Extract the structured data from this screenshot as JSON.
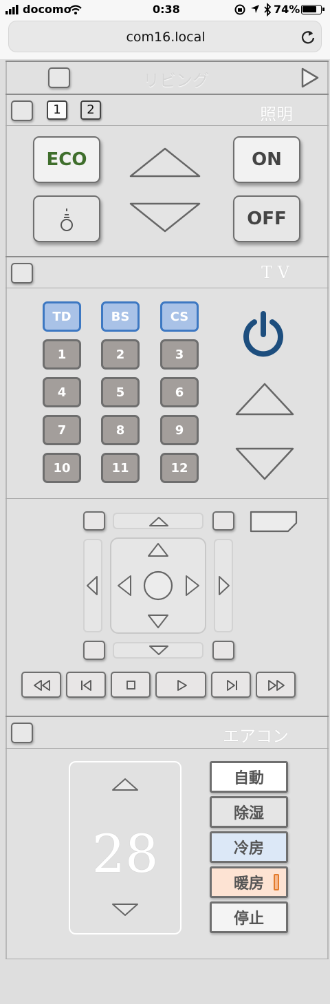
{
  "status_bar": {
    "carrier": "docomo",
    "time": "0:38",
    "battery": "74%"
  },
  "browser": {
    "url": "com16.local"
  },
  "room": {
    "title": "リビング"
  },
  "lighting": {
    "title": "照明",
    "selectors": [
      "1",
      "2"
    ],
    "eco_label": "ECO",
    "on_label": "ON",
    "off_label": "OFF",
    "eco_color": "#3f6e2c"
  },
  "tv": {
    "title": "T V",
    "sources": [
      "TD",
      "BS",
      "CS"
    ],
    "channels": [
      "1",
      "2",
      "3",
      "4",
      "5",
      "6",
      "7",
      "8",
      "9",
      "10",
      "11",
      "12"
    ],
    "source_color": "#a9c2e7",
    "power_color": "#1d4e7e"
  },
  "navigation": {
    "playback": [
      "rewind",
      "previous",
      "stop",
      "play",
      "next",
      "fast-forward"
    ]
  },
  "aircon": {
    "title": "エアコン",
    "temperature": "28",
    "modes": [
      {
        "label": "自動",
        "bg": "#ffffff"
      },
      {
        "label": "除湿",
        "bg": "#e5e5e5"
      },
      {
        "label": "冷房",
        "bg": "#dce8f7"
      },
      {
        "label": "暖房",
        "bg": "#fde3d3"
      },
      {
        "label": "停止",
        "bg": "#f4f4f4"
      }
    ],
    "heat_indicator_color": "#e27a2c"
  }
}
